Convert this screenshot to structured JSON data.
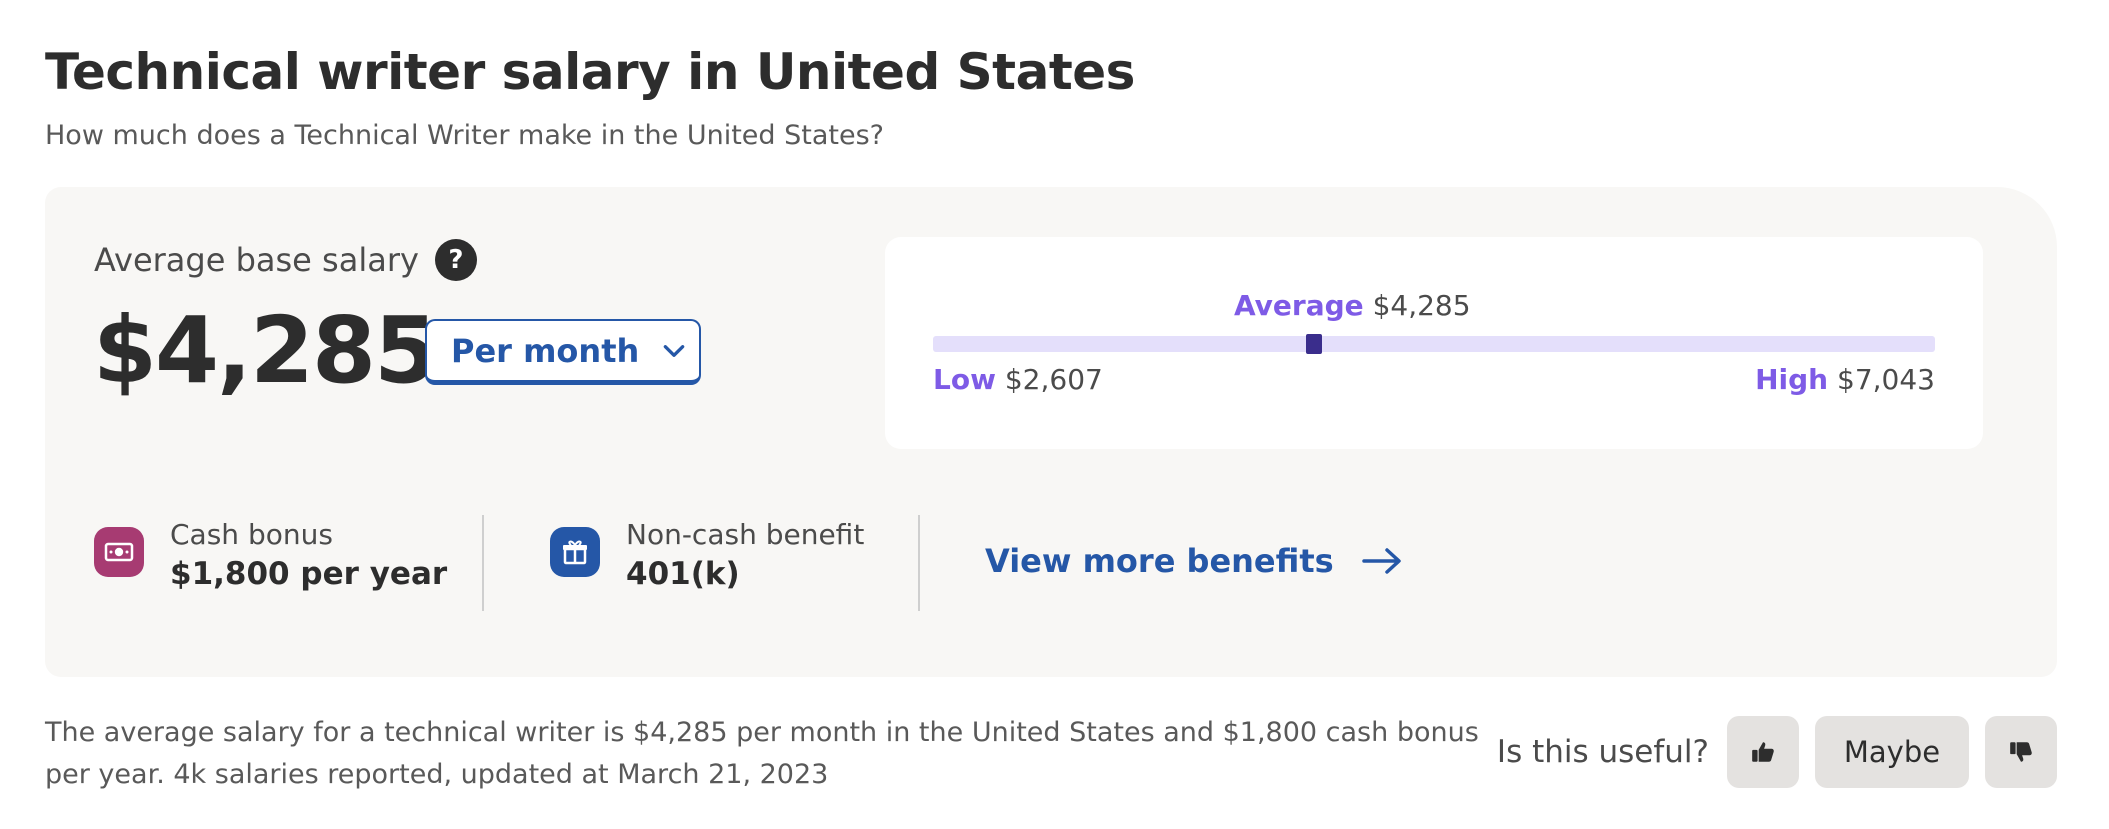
{
  "header": {
    "title": "Technical writer salary in United States",
    "subtitle": "How much does a Technical Writer make in the United States?"
  },
  "salary": {
    "label": "Average base salary",
    "help_glyph": "?",
    "value": "$4,285",
    "period": "Per month",
    "range": {
      "average_label": "Average",
      "average_value": "$4,285",
      "low_label": "Low",
      "low_value": "$2,607",
      "high_label": "High",
      "high_value": "$7,043",
      "marker_fraction": 0.38
    }
  },
  "benefits": [
    {
      "label": "Cash bonus",
      "value": "$1,800 per year",
      "icon": "cash-icon",
      "color": "#a73b72"
    },
    {
      "label": "Non-cash benefit",
      "value": "401(k)",
      "icon": "gift-icon",
      "color": "#2557a7"
    }
  ],
  "more_benefits_link": "View more benefits",
  "footer": {
    "summary": "The average salary for a technical writer is $4,285 per month in the United States and $1,800 cash bonus per year. 4k salaries reported, updated at March 21, 2023",
    "useful_question": "Is this useful?",
    "maybe_label": "Maybe"
  },
  "colors": {
    "accent_blue": "#2557a7",
    "range_purple": "#7e5be6",
    "marker": "#3a2d8c",
    "track": "#e4dffb",
    "card_bg": "#f8f7f5"
  }
}
